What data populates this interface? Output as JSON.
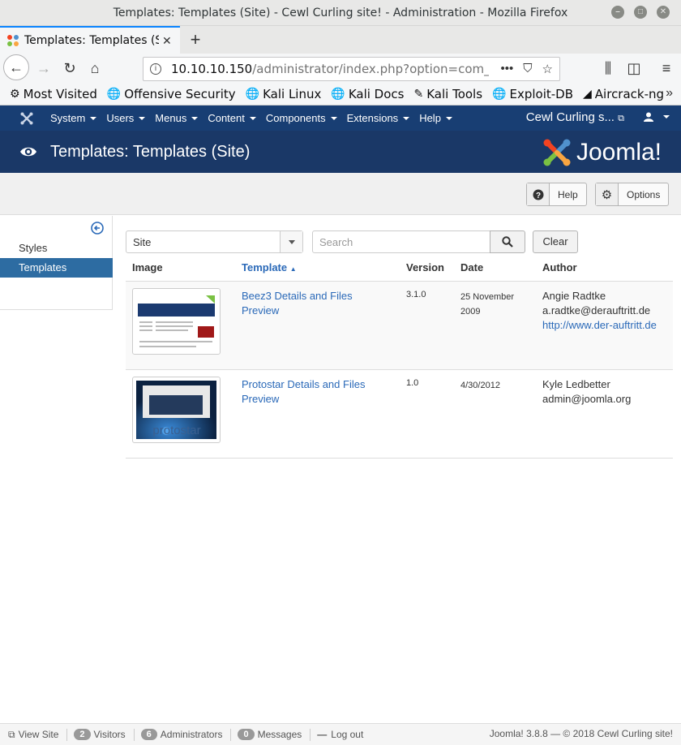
{
  "window": {
    "title": "Templates: Templates (Site) - Cewl Curling site! - Administration - Mozilla Firefox"
  },
  "browser": {
    "tab_title": "Templates: Templates (Site) - Cewl Curling site! - Administration",
    "url_host": "10.10.10.150",
    "url_path": "/administrator/index.php?option=com_templates&view=templates",
    "bookmarks": [
      {
        "label": "Most Visited",
        "icon": "gear-icon"
      },
      {
        "label": "Offensive Security",
        "icon": "globe-icon"
      },
      {
        "label": "Kali Linux",
        "icon": "globe-icon"
      },
      {
        "label": "Kali Docs",
        "icon": "globe-icon"
      },
      {
        "label": "Kali Tools",
        "icon": "tool-icon"
      },
      {
        "label": "Exploit-DB",
        "icon": "globe-icon"
      },
      {
        "label": "Aircrack-ng",
        "icon": "aircrack-icon"
      }
    ]
  },
  "joomla_nav": {
    "menus": [
      "System",
      "Users",
      "Menus",
      "Content",
      "Components",
      "Extensions",
      "Help"
    ],
    "site_name": "Cewl Curling s..."
  },
  "header": {
    "title": "Templates: Templates (Site)",
    "brand": "Joomla!"
  },
  "toolbar": {
    "help_label": "Help",
    "options_label": "Options"
  },
  "sidebar": {
    "items": [
      {
        "label": "Styles",
        "active": false
      },
      {
        "label": "Templates",
        "active": true
      }
    ]
  },
  "filters": {
    "client_value": "Site",
    "search_placeholder": "Search",
    "clear_label": "Clear"
  },
  "table": {
    "headers": {
      "image": "Image",
      "template": "Template",
      "version": "Version",
      "date": "Date",
      "author": "Author"
    },
    "rows": [
      {
        "name": "Beez3 Details and Files Preview",
        "version": "3.1.0",
        "date": "25 November 2009",
        "author_name": "Angie Radtke",
        "author_email": "a.radtke@derauftritt.de",
        "author_url": "http://www.der-auftritt.de"
      },
      {
        "name": "Protostar Details and Files Preview",
        "version": "1.0",
        "date": "4/30/2012",
        "author_name": "Kyle Ledbetter",
        "author_email": "admin@joomla.org",
        "author_url": ""
      }
    ]
  },
  "statusbar": {
    "view_site": "View Site",
    "visitors_count": "2",
    "visitors_label": "Visitors",
    "admins_count": "6",
    "admins_label": "Administrators",
    "messages_count": "0",
    "messages_label": "Messages",
    "logout_label": "Log out",
    "footer": "Joomla! 3.8.8 — © 2018 Cewl Curling site!"
  },
  "colors": {
    "joomla_nav": "#183e73",
    "joomla_header": "#1a3867",
    "link": "#2a69b8",
    "active_sidebar": "#2d6ca2"
  }
}
